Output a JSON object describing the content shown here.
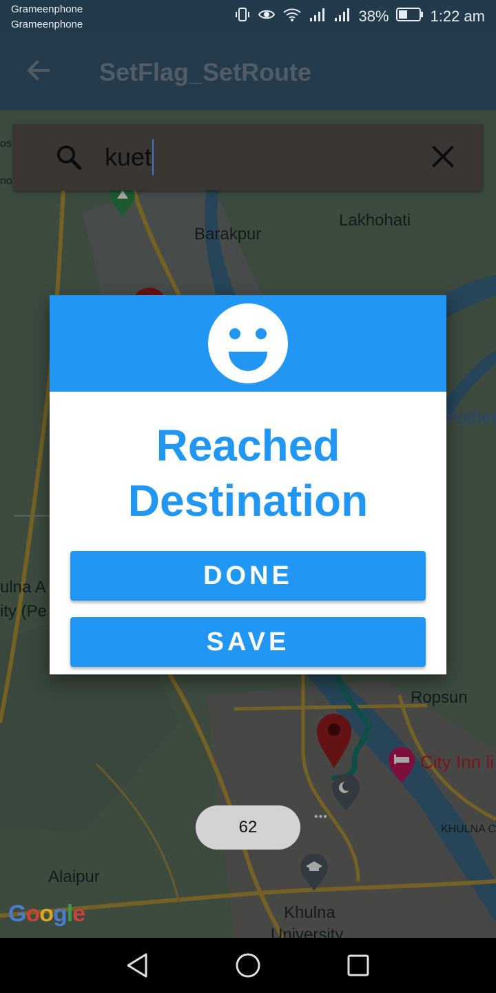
{
  "status_bar": {
    "carrier_1": "Grameenphone",
    "carrier_2": "Grameenphone",
    "battery": "38%",
    "time": "1:22 am",
    "icons": [
      "vibrate-icon",
      "eye-icon",
      "wifi-icon",
      "signal-icon",
      "signal-icon",
      "battery-icon"
    ]
  },
  "app_bar": {
    "title": "SetFlag_SetRoute",
    "back_icon": "arrow-back-icon"
  },
  "search": {
    "value": "kuet",
    "icon": "search-icon",
    "clear_icon": "close-icon"
  },
  "map": {
    "labels": {
      "barakpur": "Barakpur",
      "lakhohati": "Lakhohati",
      "pother": "Pother",
      "khulna_a": "ulna A",
      "ity_pe": "ity (Pe",
      "ropsun": "Ropsun",
      "city_inn": "City Inn li",
      "khulna_c": "KHULNA C",
      "alaipur": "Alaipur",
      "khulna_university_1": "Khulna",
      "khulna_university_2": "University",
      "os": "os",
      "no": "no"
    },
    "colors": {
      "route": "#16786e",
      "marker": "#9c1c1c",
      "hotel_pin": "#c2185b"
    }
  },
  "dialog": {
    "title_line_1": "Reached",
    "title_line_2": "Destination",
    "done_label": "DONE",
    "save_label": "SAVE",
    "header_icon": "smiley-face-icon",
    "accent": "#2196f3"
  },
  "counter": {
    "value": "62"
  },
  "google_logo": "Google",
  "nav_bar": {
    "icons": [
      "back-triangle-icon",
      "home-circle-icon",
      "recents-square-icon"
    ]
  }
}
